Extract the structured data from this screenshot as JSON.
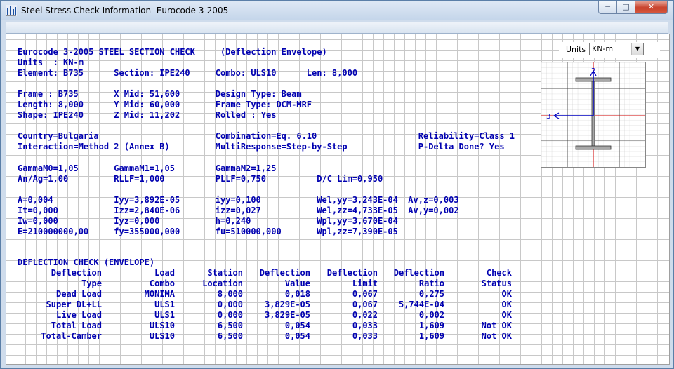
{
  "window": {
    "title": "Steel Stress Check Information  Eurocode 3-2005"
  },
  "units_control": {
    "label": "Units",
    "selected": "KN-m"
  },
  "report": {
    "header": [
      "Eurocode 3-2005 STEEL SECTION CHECK     (Deflection Envelope)",
      "Units  : KN-m",
      "Element: B735      Section: IPE240     Combo: ULS10      Len: 8,000"
    ],
    "frame_info": [
      "Frame : B735       X Mid: 51,600       Design Type: Beam",
      "Length: 8,000      Y Mid: 60,000       Frame Type: DCM-MRF",
      "Shape: IPE240      Z Mid: 11,202       Rolled : Yes"
    ],
    "design_info": [
      "Country=Bulgaria                       Combination=Eq. 6.10                    Reliability=Class 1",
      "Interaction=Method 2 (Annex B)         MultiResponse=Step-by-Step              P-Delta Done? Yes"
    ],
    "factors": [
      "GammaM0=1,05       GammaM1=1,05        GammaM2=1,25",
      "An/Ag=1,00         RLLF=1,000          PLLF=0,750          D/C Lim=0,950"
    ],
    "properties": [
      "A=0,004            Iyy=3,892E-05       iyy=0,100           Wel,yy=3,243E-04  Av,z=0,003",
      "It=0,000           Izz=2,840E-06       izz=0,027           Wel,zz=4,733E-05  Av,y=0,002",
      "Iw=0,000           Iyz=0,000           h=0,240             Wpl,yy=3,670E-04",
      "E=210000000,00     fy=355000,000       fu=510000,000       Wpl,zz=7,390E-05"
    ],
    "deflection_title": "DEFLECTION CHECK (ENVELOPE)",
    "deflection_headers": [
      [
        "Deflection",
        "Load",
        "Station",
        "Deflection",
        "Deflection",
        "Deflection",
        "Check"
      ],
      [
        "Type",
        "Combo",
        "Location",
        "Value",
        "Limit",
        "Ratio",
        "Status"
      ]
    ],
    "deflection_rows": [
      [
        "Dead Load",
        "MONIMA",
        "8,000",
        "0,018",
        "0,067",
        "0,275",
        "OK"
      ],
      [
        "Super DL+LL",
        "ULS1",
        "0,000",
        "3,829E-05",
        "0,067",
        "5,744E-04",
        "OK"
      ],
      [
        "Live Load",
        "ULS1",
        "0,000",
        "3,829E-05",
        "0,022",
        "0,002",
        "OK"
      ],
      [
        "Total Load",
        "ULS10",
        "6,500",
        "0,054",
        "0,033",
        "1,609",
        "Not OK"
      ],
      [
        "Total-Camber",
        "ULS10",
        "6,500",
        "0,054",
        "0,033",
        "1,609",
        "Not OK"
      ]
    ]
  },
  "section_diagram": {
    "axis_2_label": "2",
    "axis_3_label": "3"
  },
  "colors": {
    "report_text": "#0000b0",
    "axis_red": "#d00000",
    "section_blue": "#0000c0"
  }
}
